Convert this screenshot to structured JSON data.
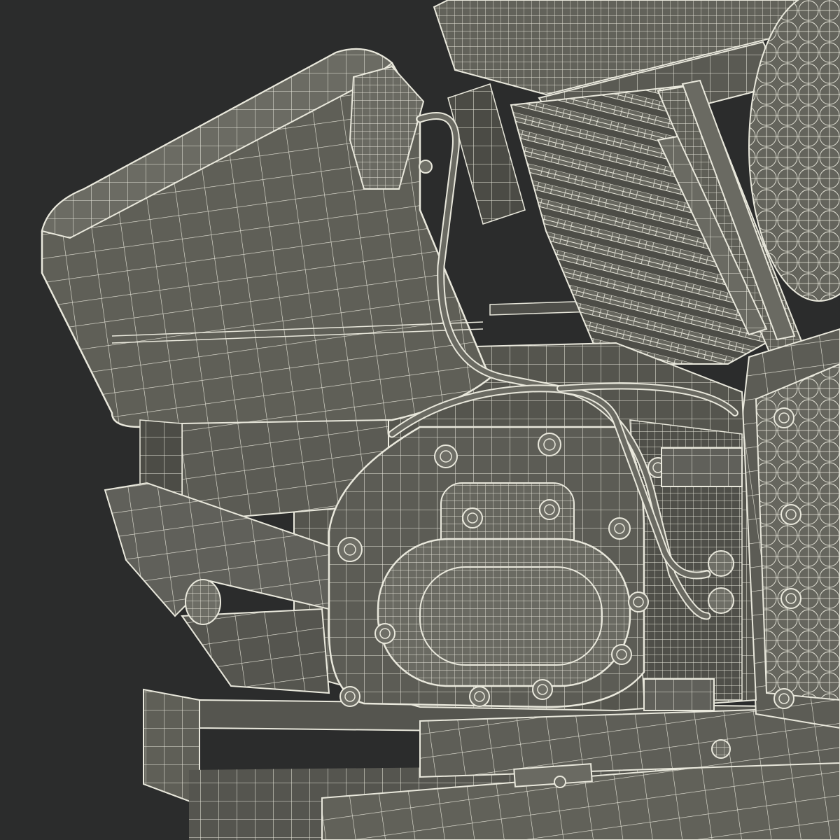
{
  "scene": {
    "subject": "motorcycle-engine-wireframe-render",
    "background_color": "#2b2c2c",
    "surface_color": "#5f5f57",
    "surface_dark_color": "#4b4b45",
    "wire_color": "#e9e8dc"
  }
}
